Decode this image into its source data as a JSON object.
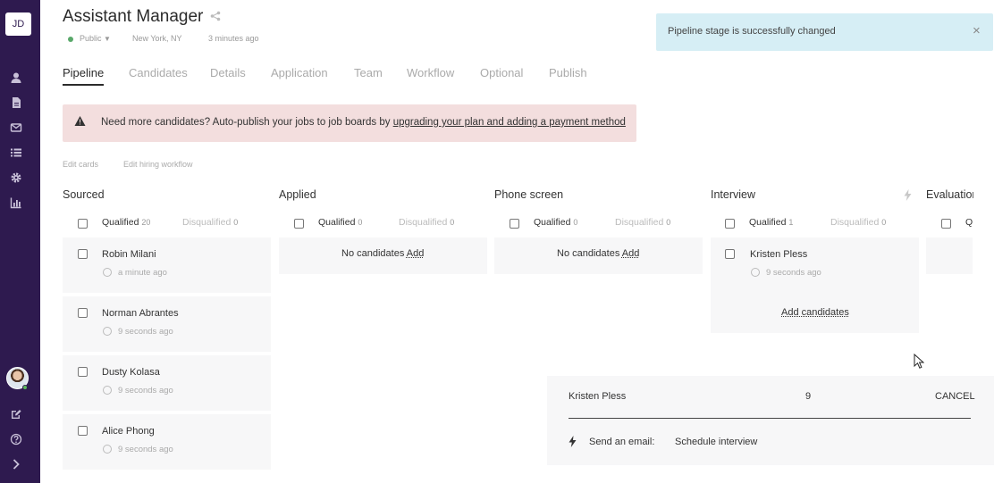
{
  "sidebar": {
    "logo": "JD",
    "icons": [
      "user-icon",
      "document-icon",
      "mail-icon",
      "list-icon",
      "gear-icon",
      "chart-icon"
    ],
    "bottom_icons": [
      "edit-icon",
      "help-icon",
      "chevron-right-icon"
    ]
  },
  "header": {
    "title": "Assistant Manager",
    "visibility": "Public",
    "location": "New York, NY",
    "updated": "3 minutes ago"
  },
  "tabs": [
    "Pipeline",
    "Candidates",
    "Details",
    "Application",
    "Team",
    "Workflow",
    "Optional",
    "Publish"
  ],
  "alert": {
    "text": "Need more candidates? Auto-publish your jobs to job boards by",
    "link": "upgrading your plan and adding a payment method"
  },
  "links": {
    "edit_cards": "Edit cards",
    "edit_workflow": "Edit hiring workflow"
  },
  "columns": [
    {
      "title": "Sourced",
      "qualified_label": "Qualified",
      "qualified_count": "20",
      "disqualified_label": "Disqualified",
      "disqualified_count": "0",
      "cards": [
        {
          "name": "Robin Milani",
          "time": "a minute ago"
        },
        {
          "name": "Norman Abrantes",
          "time": "9 seconds ago"
        },
        {
          "name": "Dusty Kolasa",
          "time": "9 seconds ago"
        },
        {
          "name": "Alice Phong",
          "time": "9 seconds ago"
        }
      ]
    },
    {
      "title": "Applied",
      "qualified_label": "Qualified",
      "qualified_count": "0",
      "disqualified_label": "Disqualified",
      "disqualified_count": "0",
      "empty": "No candidates",
      "add": "Add"
    },
    {
      "title": "Phone screen",
      "qualified_label": "Qualified",
      "qualified_count": "0",
      "disqualified_label": "Disqualified",
      "disqualified_count": "0",
      "empty": "No candidates",
      "add": "Add"
    },
    {
      "title": "Interview",
      "qualified_label": "Qualified",
      "qualified_count": "1",
      "disqualified_label": "Disqualified",
      "disqualified_count": "0",
      "cards": [
        {
          "name": "Kristen Pless",
          "time": "9 seconds ago"
        }
      ],
      "add_candidates": "Add candidates"
    },
    {
      "title": "Evaluation",
      "qualified_label": "Q"
    }
  ],
  "toast": {
    "text": "Pipeline stage is successfully changed"
  },
  "action_panel": {
    "name": "Kristen Pless",
    "number": "9",
    "cancel": "CANCEL",
    "action_label": "Send an email:",
    "action_value": "Schedule interview"
  }
}
